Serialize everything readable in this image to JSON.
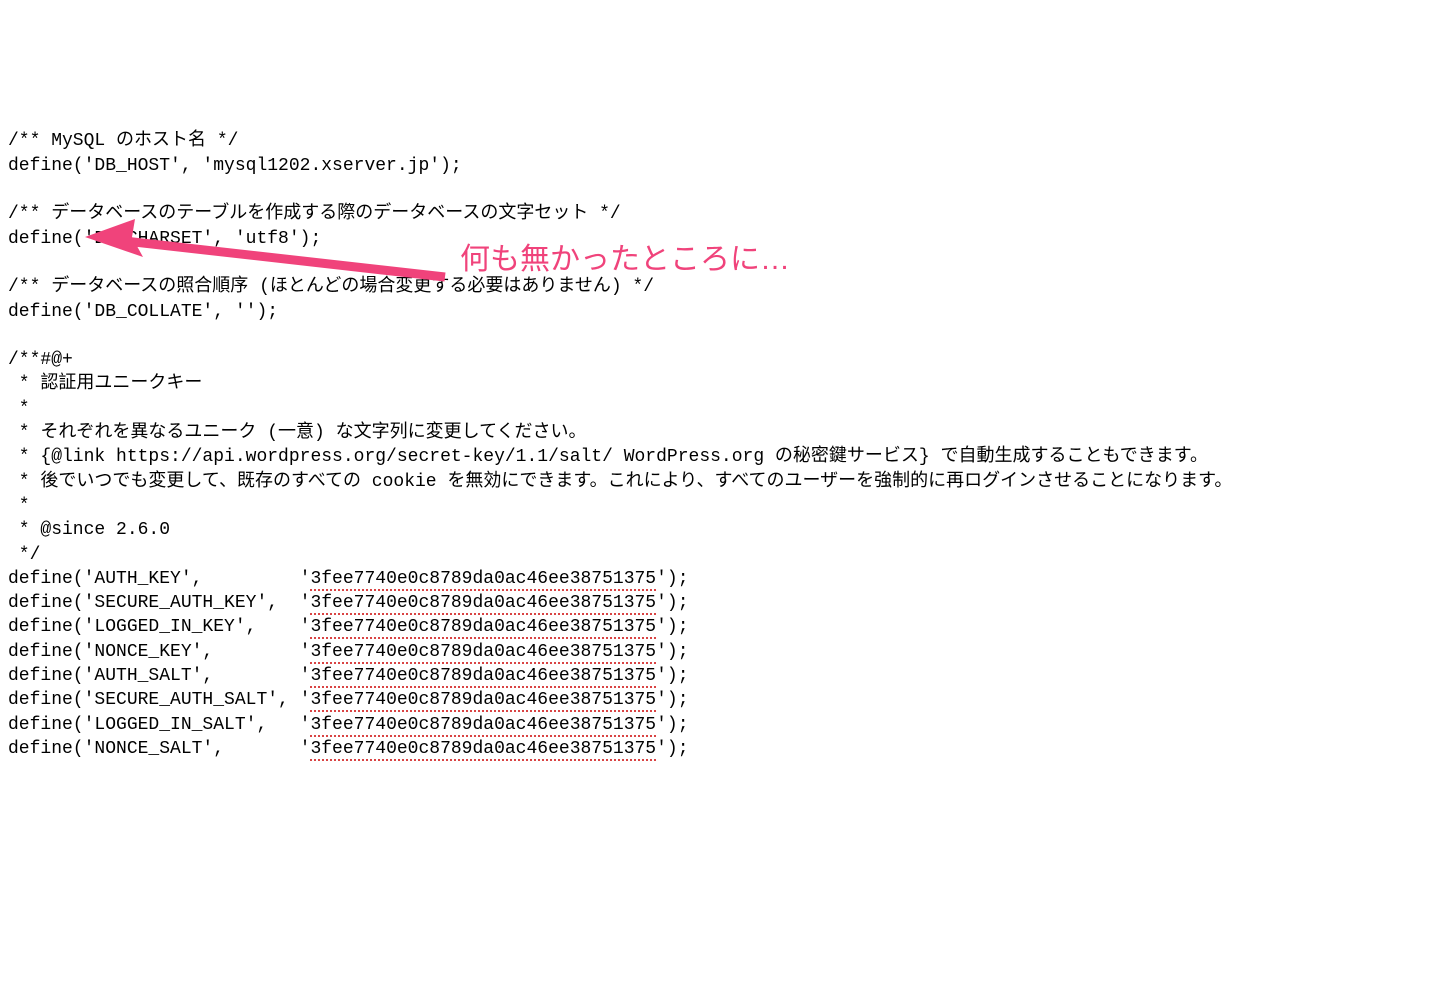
{
  "code": {
    "c1": "/** MySQL のホスト名 */",
    "l1": "define('DB_HOST', 'mysql1202.xserver.jp');",
    "c2": "/** データベースのテーブルを作成する際のデータベースの文字セット */",
    "l2": "define('DB_CHARSET', 'utf8');",
    "c3": "/** データベースの照合順序 (ほとんどの場合変更する必要はありません) */",
    "l3": "define('DB_COLLATE', '');",
    "block_open": "/**#@+",
    "b1": " * 認証用ユニークキー",
    "b2": " *",
    "b3": " * それぞれを異なるユニーク (一意) な文字列に変更してください。",
    "b4": " * {@link https://api.wordpress.org/secret-key/1.1/salt/ WordPress.org の秘密鍵サービス} で自動生成することもできます。",
    "b5": " * 後でいつでも変更して、既存のすべての cookie を無効にできます。これにより、すべてのユーザーを強制的に再ログインさせることになります。",
    "b6": " *",
    "b7": " * @since 2.6.0",
    "block_close": " */",
    "keys": [
      {
        "name": "AUTH_KEY",
        "col": "define('AUTH_KEY',         '",
        "val": "3fee7740e0c8789da0ac46ee38751375",
        "end": "');"
      },
      {
        "name": "SECURE_AUTH_KEY",
        "col": "define('SECURE_AUTH_KEY',  '",
        "val": "3fee7740e0c8789da0ac46ee38751375",
        "end": "');"
      },
      {
        "name": "LOGGED_IN_KEY",
        "col": "define('LOGGED_IN_KEY',    '",
        "val": "3fee7740e0c8789da0ac46ee38751375",
        "end": "');"
      },
      {
        "name": "NONCE_KEY",
        "col": "define('NONCE_KEY',        '",
        "val": "3fee7740e0c8789da0ac46ee38751375",
        "end": "');"
      },
      {
        "name": "AUTH_SALT",
        "col": "define('AUTH_SALT',        '",
        "val": "3fee7740e0c8789da0ac46ee38751375",
        "end": "');"
      },
      {
        "name": "SECURE_AUTH_SALT",
        "col": "define('SECURE_AUTH_SALT', '",
        "val": "3fee7740e0c8789da0ac46ee38751375",
        "end": "');"
      },
      {
        "name": "LOGGED_IN_SALT",
        "col": "define('LOGGED_IN_SALT',   '",
        "val": "3fee7740e0c8789da0ac46ee38751375",
        "end": "');"
      },
      {
        "name": "NONCE_SALT",
        "col": "define('NONCE_SALT',       '",
        "val": "3fee7740e0c8789da0ac46ee38751375",
        "end": "');"
      }
    ]
  },
  "annotation": {
    "text": "何も無かったところに…"
  }
}
